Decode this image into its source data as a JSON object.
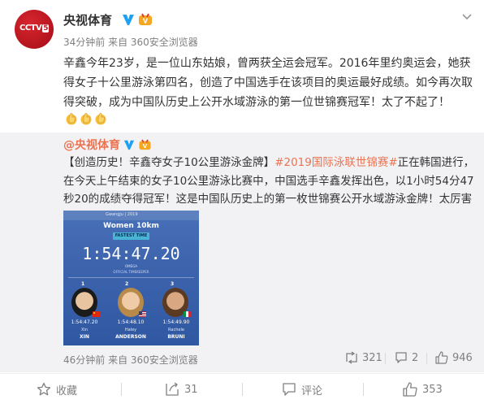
{
  "post": {
    "author": "央视体育",
    "meta": "34分钟前 来自 360安全浏览器",
    "text": "辛鑫今年23岁，是一位山东姑娘，曾两获全运会冠军。2016年里约奥运会，她获得女子十公里游泳第四名，创造了中国选手在该项目的奥运最好成绩。如今再次取得突破，成为中国队历史上公开水域游泳的第一位世锦赛冠军！太了不起了！",
    "avatar_text": "CCTV",
    "avatar_num": "5"
  },
  "quoted": {
    "author": "@央视体育",
    "text_prefix": "【创造历史！辛鑫夺女子10公里游泳金牌】",
    "hashtag": "#2019国际泳联世锦赛#",
    "text_body": "正在韩国进行，在今天上午结束的女子10公里游泳比赛中，中国选手辛鑫发挥出色，以1小时54分47秒20的成绩夺得冠军！这是中国队历史上的第一枚世锦赛公开水域游泳金牌！太厉害了！",
    "meta": "46分钟前 来自 360安全浏览器",
    "repost_count": "321",
    "comment_count": "2",
    "like_count": "946",
    "photo": {
      "logo": "Gwangju | 2019",
      "title": "Women 10km",
      "subtitle": "FASTEST TIME",
      "time": "1:54:47.20",
      "omega": "OMEGA",
      "official": "OFFICIAL TIMEKEEPER",
      "podium": [
        {
          "rank": "1",
          "time": "1:54:47.20",
          "first": "Xin",
          "last": "XIN"
        },
        {
          "rank": "2",
          "time": "1:54:48.10",
          "first": "Haley",
          "last": "ANDERSON"
        },
        {
          "rank": "3",
          "time": "1:54:49.90",
          "first": "Rachele",
          "last": "BRUNI"
        }
      ]
    }
  },
  "actions": {
    "favorite": "收藏",
    "repost": "31",
    "comment": "评论",
    "like": "353"
  },
  "colors": {
    "link": "#eb7350",
    "meta": "#808080",
    "quote_bg": "#f2f2f5",
    "verified": "#1ea1f2",
    "vip": "#f5a623"
  }
}
